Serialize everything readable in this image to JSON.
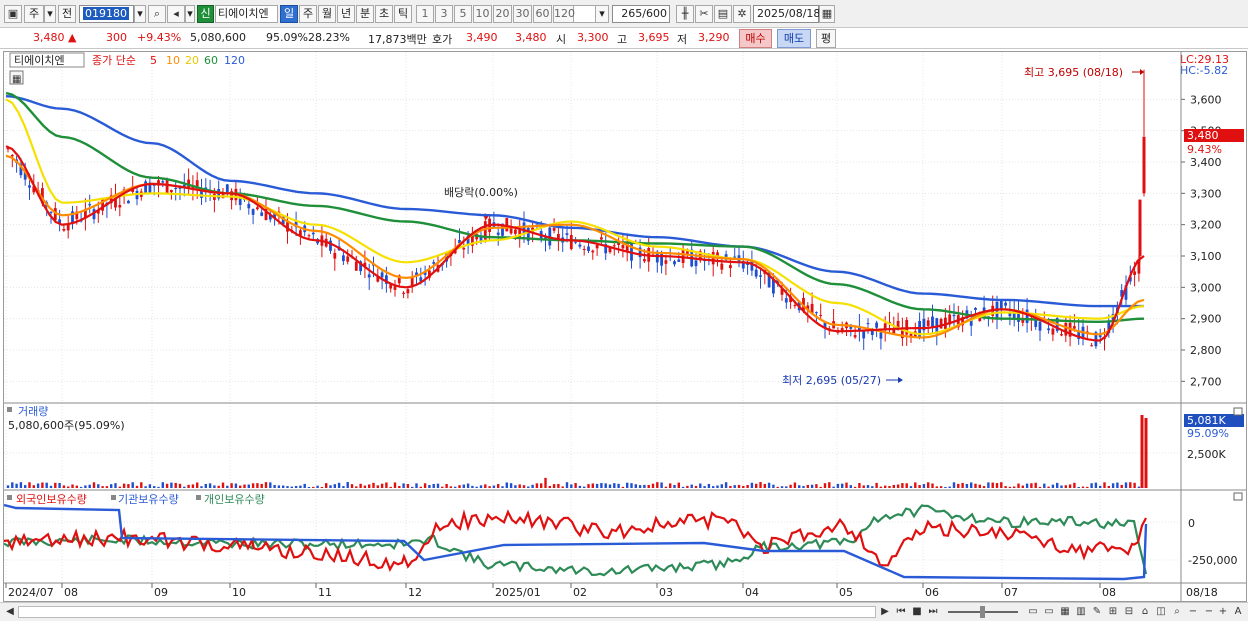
{
  "toolbar": {
    "period_type": "주",
    "prev_label": "전",
    "stock_code": "019180",
    "badge_new": "신",
    "stock_name": "티에이치엔",
    "period_buttons": [
      "일",
      "주",
      "월",
      "년",
      "분",
      "초",
      "틱"
    ],
    "active_period": "일",
    "interval_buttons": [
      "1",
      "3",
      "5",
      "10",
      "20",
      "30",
      "60",
      "120"
    ],
    "count_value": "265",
    "count_total": "/600",
    "date_value": "2025/08/18"
  },
  "quote": {
    "price": "3,480",
    "up_arrow": "▲",
    "change": "300",
    "change_pct": "+9.43%",
    "volume": "5,080,600",
    "volume_ratio": "95.09%",
    "turnover": "28.23%",
    "amount": "17,873백만",
    "hoga_label": "호가",
    "hoga_value": "3,490",
    "ask_value": "3,480",
    "open_label": "시",
    "open_value": "3,300",
    "high_label": "고",
    "high_value": "3,695",
    "low_label": "저",
    "low_value": "3,290",
    "buy_label": "매수",
    "sell_label": "매도",
    "eval_label": "평"
  },
  "price_panel": {
    "legend_name": "티에이치엔",
    "legend_ma_label": "종가 단순",
    "ma_periods": [
      "5",
      "10",
      "20",
      "60",
      "120"
    ],
    "ma_colors": [
      "#e01010",
      "#ff8c00",
      "#f5e000",
      "#1f8f3a",
      "#2a5bd7"
    ],
    "lc_label": "LC:29.13",
    "hc_label": "HC:-5.82",
    "y_ticks": [
      "3,600",
      "3,500",
      "3,400",
      "3,300",
      "3,200",
      "3,100",
      "3,000",
      "2,900",
      "2,800",
      "2,700"
    ],
    "y_values": [
      3600,
      3500,
      3400,
      3300,
      3200,
      3100,
      3000,
      2900,
      2800,
      2700
    ],
    "current_price_tag": "3,480",
    "current_pct_tag": "9.43%",
    "high_annotation": "최고 3,695 (08/18)",
    "low_annotation": "최저 2,695 (05/27)",
    "dividend_annotation": "배당락(0.00%)"
  },
  "volume_panel": {
    "title": "거래량",
    "volume_text": "5,080,600주(95.09%)",
    "tag_value": "5,081K",
    "tag_pct": "95.09%",
    "tick_label": "2,500K"
  },
  "holdings_panel": {
    "legend": [
      {
        "label": "외국인보유수량",
        "color": "#e01010"
      },
      {
        "label": "기관보유수량",
        "color": "#2a5bd7"
      },
      {
        "label": "개인보유수량",
        "color": "#2e8b57"
      }
    ],
    "y_ticks": [
      "0",
      "-250,000"
    ]
  },
  "x_axis": {
    "labels": [
      "2024/07",
      "08",
      "09",
      "10",
      "11",
      "12",
      "2025/01",
      "02",
      "03",
      "04",
      "05",
      "06",
      "07",
      "08",
      "08/18"
    ]
  },
  "chart_data": {
    "type": "line",
    "title": "",
    "x_range": [
      "2024/07",
      "2025/08/18"
    ],
    "ylim": [
      2650,
      3700
    ],
    "series": [
      {
        "name": "5",
        "color": "#e01010",
        "x": [
          "2024/07",
          "08",
          "09",
          "10",
          "11",
          "12",
          "2025/01",
          "02",
          "03",
          "04",
          "05",
          "06",
          "07",
          "08",
          "08/18"
        ],
        "values": [
          3450,
          3200,
          3330,
          3300,
          3150,
          3000,
          3200,
          3150,
          3100,
          3080,
          2860,
          2870,
          2930,
          2830,
          3100
        ]
      },
      {
        "name": "10",
        "color": "#ff8c00",
        "x": [
          "2024/07",
          "08",
          "09",
          "10",
          "11",
          "12",
          "2025/01",
          "02",
          "03",
          "04",
          "05",
          "06",
          "07",
          "08",
          "08/18"
        ],
        "values": [
          3420,
          3230,
          3330,
          3300,
          3180,
          3030,
          3190,
          3200,
          3110,
          3090,
          2880,
          2840,
          2930,
          2850,
          2960
        ]
      },
      {
        "name": "20",
        "color": "#f5e000",
        "x": [
          "2024/07",
          "08",
          "09",
          "10",
          "11",
          "12",
          "2025/01",
          "02",
          "03",
          "04",
          "05",
          "06",
          "07",
          "08",
          "08/18"
        ],
        "values": [
          3600,
          3270,
          3300,
          3290,
          3200,
          3080,
          3150,
          3210,
          3130,
          3090,
          2950,
          2850,
          2920,
          2900,
          2940
        ]
      },
      {
        "name": "60",
        "color": "#1f8f3a",
        "x": [
          "2024/07",
          "08",
          "09",
          "10",
          "11",
          "12",
          "2025/01",
          "02",
          "03",
          "04",
          "05",
          "06",
          "07",
          "08",
          "08/18"
        ],
        "values": [
          3620,
          3480,
          3350,
          3300,
          3260,
          3210,
          3160,
          3150,
          3140,
          3130,
          3010,
          2930,
          2900,
          2890,
          2900
        ]
      },
      {
        "name": "120",
        "color": "#2a5bd7",
        "x": [
          "2024/07",
          "08",
          "09",
          "10",
          "11",
          "12",
          "2025/01",
          "02",
          "03",
          "04",
          "05",
          "06",
          "07",
          "08",
          "08/18"
        ],
        "values": [
          3610,
          3570,
          3460,
          3340,
          3300,
          3250,
          3230,
          3190,
          3160,
          3130,
          3050,
          2980,
          2960,
          2940,
          2940
        ]
      }
    ],
    "annotations": {
      "high": {
        "date": "08/18",
        "value": 3695
      },
      "low": {
        "date": "05/27",
        "value": 2695
      },
      "last_close": 3480
    }
  }
}
